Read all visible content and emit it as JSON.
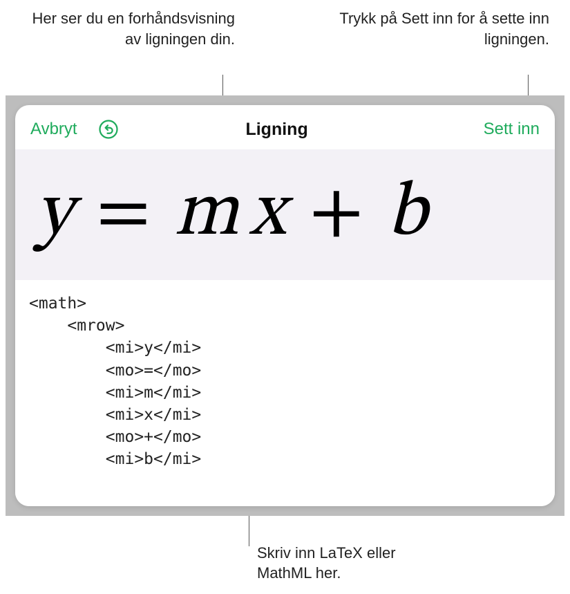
{
  "callouts": {
    "preview": "Her ser du en forhåndsvisning av ligningen din.",
    "insert": "Trykk på Sett inn for å sette inn ligningen.",
    "input": "Skriv inn LaTeX eller MathML her."
  },
  "toolbar": {
    "cancel": "Avbryt",
    "undo_icon": "undo",
    "title": "Ligning",
    "insert": "Sett inn"
  },
  "preview": {
    "equation_display": "y = mx + b"
  },
  "code": {
    "value": "<math>\n    <mrow>\n        <mi>y</mi>\n        <mo>=</mo>\n        <mi>m</mi>\n        <mi>x</mi>\n        <mo>+</mo>\n        <mi>b</mi>"
  },
  "colors": {
    "accent": "#1fab5c",
    "preview_bg": "#f3f1f6",
    "frame_bg": "#bdbdbd"
  }
}
